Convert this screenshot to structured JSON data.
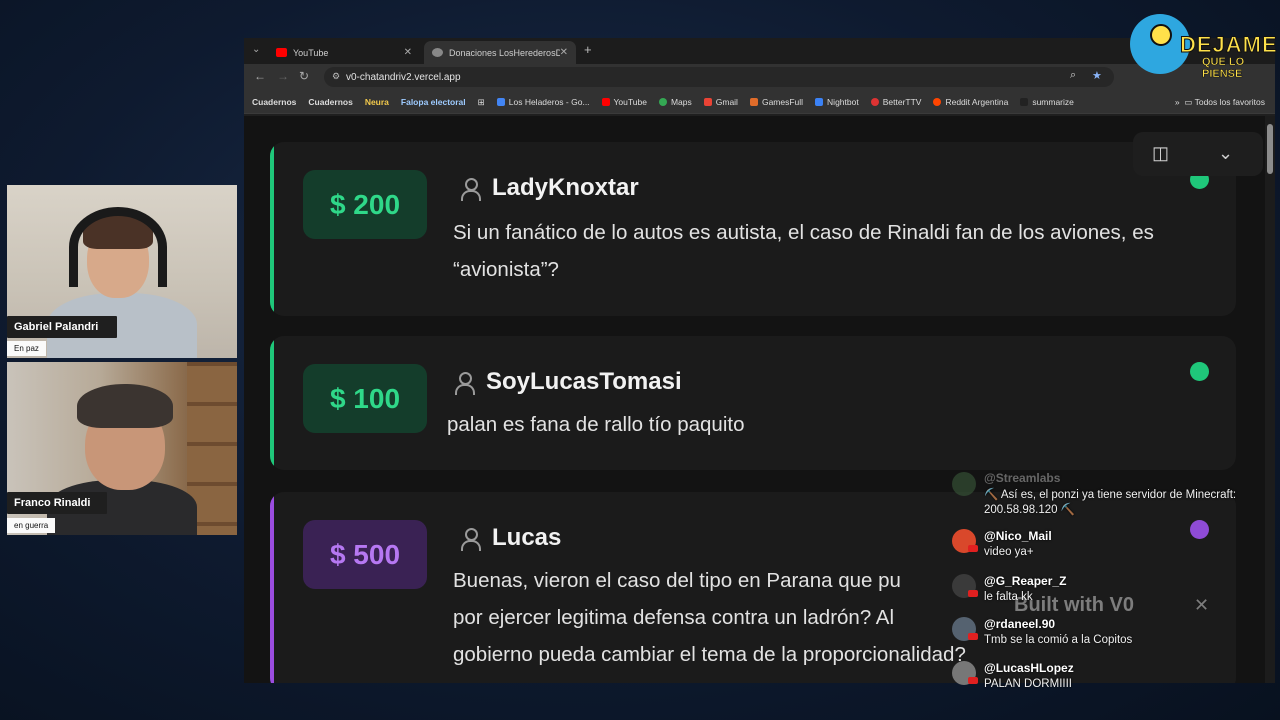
{
  "webcams": [
    {
      "name": "Gabriel Palandri",
      "status": "En paz"
    },
    {
      "name": "Franco Rinaldi",
      "status": "en guerra"
    }
  ],
  "logo": {
    "line1": "DEJAME",
    "line2": "QUE LO PIENSE"
  },
  "browser": {
    "tabs": [
      {
        "label": "YouTube",
        "favicon_color": "#ff0000"
      },
      {
        "label": "Donaciones LosHerederosDeAl",
        "favicon_color": "#888888",
        "active": true
      }
    ],
    "url": "v0-chatandriv2.vercel.app",
    "bookmarks": [
      {
        "label": "Cuadernos",
        "bold": true
      },
      {
        "label": "Cuadernos",
        "bold": true
      },
      {
        "label": "Neura",
        "bold": true,
        "color": "#f2c94c"
      },
      {
        "label": "Falopa electoral",
        "bold": true,
        "color": "#9ecbff"
      },
      {
        "label": "Los Heladeros - Go...",
        "icon_color": "#4285f4"
      },
      {
        "label": "YouTube",
        "icon_color": "#ff0000"
      },
      {
        "label": "Maps",
        "icon_color": "#34a853"
      },
      {
        "label": "Gmail",
        "icon_color": "#ea4335"
      },
      {
        "label": "GamesFull",
        "icon_color": "#e06c2a"
      },
      {
        "label": "Nightbot",
        "icon_color": "#3b82f6"
      },
      {
        "label": "BetterTTV",
        "icon_color": "#d33"
      },
      {
        "label": "Reddit Argentina",
        "icon_color": "#ff4500"
      },
      {
        "label": "summarize",
        "icon_color": "#222"
      }
    ],
    "bookmarks_right": "Todos los favoritos"
  },
  "donations": [
    {
      "amount": "$ 200",
      "user": "LadyKnoxtar",
      "message": "Si un fanático de lo autos es autista, el caso de Rinaldi fan de los aviones, es “avionista”?",
      "accent": "#1fc77a",
      "amount_bg": "#143d2b",
      "amount_color": "#2fd889",
      "dot": "#1fc77a"
    },
    {
      "amount": "$ 100",
      "user": "SoyLucasTomasi",
      "message": "palan es fana de rallo tío paquito",
      "accent": "#1fc77a",
      "amount_bg": "#143d2b",
      "amount_color": "#2fd889",
      "dot": "#1fc77a"
    },
    {
      "amount": "$ 500",
      "user": "Lucas",
      "message": "Buenas, vieron el caso del tipo en Parana que pu... por ejercer legitima defensa contra un ladrón? Al... gobierno pueda cambiar el tema de la proporcionalidad?",
      "accent": "#9b4de0",
      "amount_bg": "#3a2254",
      "amount_color": "#b678f2",
      "dot": "#8f4bd6"
    }
  ],
  "donation3_lines": [
    "Buenas, vieron el caso del tipo en Parana que pu",
    "por ejercer legitima defensa contra un ladrón? Al",
    "gobierno pueda cambiar el tema de la proporcionalidad?"
  ],
  "v0_badge": {
    "text": "Built with",
    "brand": "V0"
  },
  "chat": [
    {
      "user": "@Streamlabs",
      "text": "⛏️ Así es, el ponzi ya tiene servidor de Minecraft: 200.58.98.120 ⛏️",
      "avatar_color": "#3a5a3a"
    },
    {
      "user": "@Nico_Mail",
      "text": "video ya+",
      "avatar_color": "#d9482b"
    },
    {
      "user": "@G_Reaper_Z",
      "text": "le falta kk",
      "avatar_color": "#3a3a3a"
    },
    {
      "user": "@rdaneel.90",
      "text": "Tmb se la comió a la Copitos",
      "avatar_color": "#556270"
    },
    {
      "user": "@LucasHLopez",
      "text": "PALAN DORMIIII",
      "avatar_color": "#777777"
    }
  ]
}
